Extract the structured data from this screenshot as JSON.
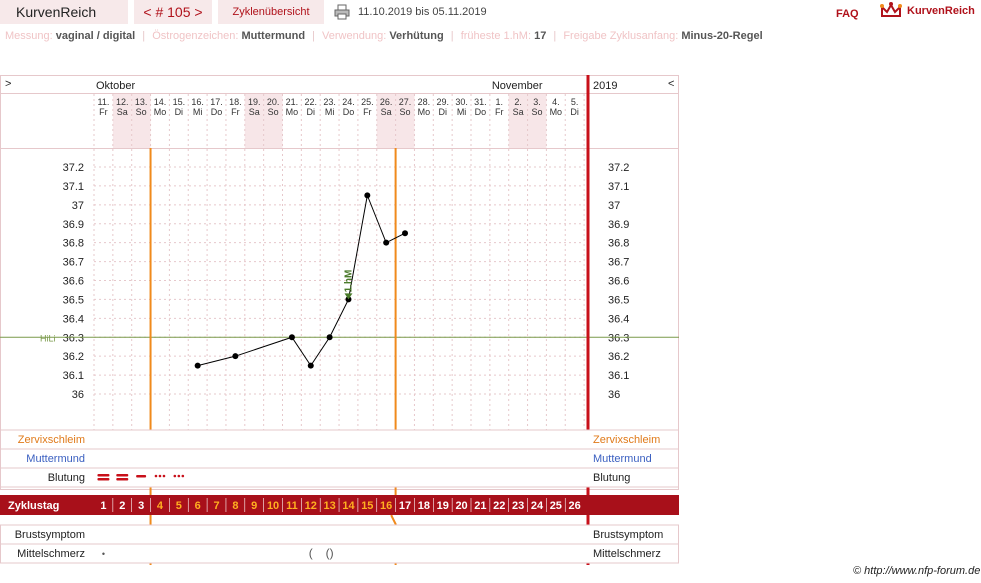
{
  "topbar": {
    "brand": "KurvenReich",
    "cycle_nav": "< # 105 >",
    "overview_tab": "Zyklenübersicht",
    "date_range": "11.10.2019 bis 05.11.2019",
    "faq": "FAQ",
    "logo_text": "KurvenReich",
    "printer_icon": "printer-icon",
    "logo_icon": "kurvenreich-crown-icon"
  },
  "settings": [
    {
      "label": "Messung:",
      "value": "vaginal / digital"
    },
    {
      "label": "Östrogenzeichen:",
      "value": "Muttermund"
    },
    {
      "label": "Verwendung:",
      "value": "Verhütung"
    },
    {
      "label": "früheste 1.hM:",
      "value": "17"
    },
    {
      "label": "Freigabe Zyklusanfang:",
      "value": "Minus-20-Regel"
    }
  ],
  "nav": {
    "prev": ">",
    "next": "<"
  },
  "chart_data": {
    "type": "line",
    "months": [
      {
        "label": "Oktober",
        "start_index": 0
      },
      {
        "label": "November",
        "start_index": 21
      }
    ],
    "year_label": "2019",
    "days": [
      {
        "d": "11.",
        "w": "Fr",
        "we": false
      },
      {
        "d": "12.",
        "w": "Sa",
        "we": true
      },
      {
        "d": "13.",
        "w": "So",
        "we": true
      },
      {
        "d": "14.",
        "w": "Mo",
        "we": false
      },
      {
        "d": "15.",
        "w": "Di",
        "we": false
      },
      {
        "d": "16.",
        "w": "Mi",
        "we": false
      },
      {
        "d": "17.",
        "w": "Do",
        "we": false
      },
      {
        "d": "18.",
        "w": "Fr",
        "we": false
      },
      {
        "d": "19.",
        "w": "Sa",
        "we": true
      },
      {
        "d": "20.",
        "w": "So",
        "we": true
      },
      {
        "d": "21.",
        "w": "Mo",
        "we": false
      },
      {
        "d": "22.",
        "w": "Di",
        "we": false
      },
      {
        "d": "23.",
        "w": "Mi",
        "we": false
      },
      {
        "d": "24.",
        "w": "Do",
        "we": false
      },
      {
        "d": "25.",
        "w": "Fr",
        "we": false
      },
      {
        "d": "26.",
        "w": "Sa",
        "we": true
      },
      {
        "d": "27.",
        "w": "So",
        "we": true
      },
      {
        "d": "28.",
        "w": "Mo",
        "we": false
      },
      {
        "d": "29.",
        "w": "Di",
        "we": false
      },
      {
        "d": "30.",
        "w": "Mi",
        "we": false
      },
      {
        "d": "31.",
        "w": "Do",
        "we": false
      },
      {
        "d": "1.",
        "w": "Fr",
        "we": false
      },
      {
        "d": "2.",
        "w": "Sa",
        "we": true
      },
      {
        "d": "3.",
        "w": "So",
        "we": true
      },
      {
        "d": "4.",
        "w": "Mo",
        "we": false
      },
      {
        "d": "5.",
        "w": "Di",
        "we": false
      }
    ],
    "yticks": [
      "37.2",
      "37.1",
      "37",
      "36.9",
      "36.8",
      "36.7",
      "36.6",
      "36.5",
      "36.4",
      "36.3",
      "36.2",
      "36.1",
      "36"
    ],
    "ylim": [
      36.0,
      37.2
    ],
    "temperatures": [
      {
        "day": 6,
        "value": 36.15
      },
      {
        "day": 8,
        "value": 36.2
      },
      {
        "day": 11,
        "value": 36.3
      },
      {
        "day": 12,
        "value": 36.15
      },
      {
        "day": 13,
        "value": 36.3
      },
      {
        "day": 14,
        "value": 36.5
      },
      {
        "day": 15,
        "value": 37.05
      },
      {
        "day": 16,
        "value": 36.8
      },
      {
        "day": 17,
        "value": 36.85
      }
    ],
    "hilo_label": "HiLi",
    "hilo_value": 36.3,
    "hm_label": "1.hM",
    "hm_day": 14,
    "hm_value": 36.5,
    "cycle_start_marker_after_day": 3,
    "ovulation_marker_after_day": 16,
    "rows": {
      "zervix": "Zervixschleim",
      "mumu": "Muttermund",
      "blutung": "Blutung",
      "zyklustag": "Zyklustag",
      "brust": "Brustsymptom",
      "mittel": "Mittelschmerz"
    },
    "cycle_days": [
      "1",
      "2",
      "3",
      "4",
      "5",
      "6",
      "7",
      "8",
      "9",
      "10",
      "11",
      "12",
      "13",
      "14",
      "15",
      "16",
      "17",
      "18",
      "19",
      "20",
      "21",
      "22",
      "23",
      "24",
      "25",
      "26"
    ],
    "highlight_cycle_days_range": [
      4,
      16
    ],
    "bleeding": [
      {
        "day": 1,
        "type": "heavy"
      },
      {
        "day": 2,
        "type": "heavy"
      },
      {
        "day": 3,
        "type": "medium"
      },
      {
        "day": 4,
        "type": "light"
      },
      {
        "day": 5,
        "type": "light"
      }
    ],
    "mittelschmerz_marks": [
      {
        "day": 1,
        "symbol": "•"
      },
      {
        "day": 12,
        "symbol": "("
      },
      {
        "day": 13,
        "symbol": "()"
      }
    ],
    "colors": {
      "accent": "#b0121b",
      "grid": "#e6c8cb",
      "weekend": "#f7e6e8",
      "orange": "#f08a1c",
      "hilo": "#7a9a4a",
      "hm": "#4a7a2a",
      "zervix": "#e07a1a",
      "mumu": "#3a5fc0"
    }
  },
  "copyright": "© http://www.nfp-forum.de"
}
